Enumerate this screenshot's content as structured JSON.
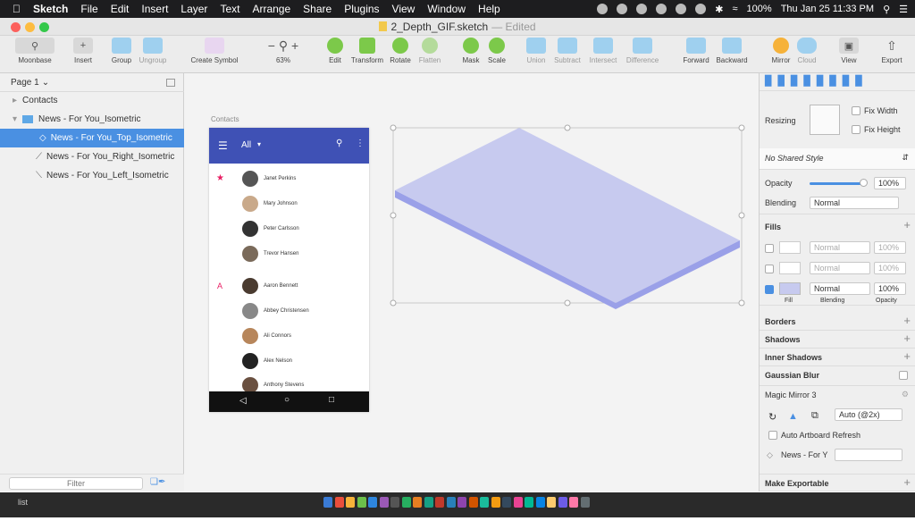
{
  "menubar": {
    "app": "Sketch",
    "items": [
      "File",
      "Edit",
      "Insert",
      "Layer",
      "Text",
      "Arrange",
      "Share",
      "Plugins",
      "View",
      "Window",
      "Help"
    ],
    "battery": "100%",
    "clock": "Thu Jan 25  11:33 PM"
  },
  "window": {
    "title": "2_Depth_GIF.sketch",
    "edited": "— Edited"
  },
  "toolbar": {
    "moonbase": "Moonbase",
    "insert": "Insert",
    "group": "Group",
    "ungroup": "Ungroup",
    "create_symbol": "Create Symbol",
    "zoom": "63%",
    "edit": "Edit",
    "transform": "Transform",
    "rotate": "Rotate",
    "flatten": "Flatten",
    "mask": "Mask",
    "scale": "Scale",
    "union": "Union",
    "subtract": "Subtract",
    "intersect": "Intersect",
    "difference": "Difference",
    "forward": "Forward",
    "backward": "Backward",
    "mirror": "Mirror",
    "cloud": "Cloud",
    "view": "View",
    "export": "Export"
  },
  "layers": {
    "page": "Page 1",
    "items": [
      {
        "label": "Contacts"
      },
      {
        "label": "News - For You_Isometric"
      },
      {
        "label": "News - For You_Top_Isometric"
      },
      {
        "label": "News - For You_Right_Isometric"
      },
      {
        "label": "News - For You_Left_Isometric"
      }
    ],
    "filter_placeholder": "Filter"
  },
  "canvas": {
    "artboard_label": "Contacts",
    "phone": {
      "toolbar_title": "All",
      "contacts": [
        {
          "name": "Janet Perkins"
        },
        {
          "name": "Mary Johnson"
        },
        {
          "name": "Peter Carlsson"
        },
        {
          "name": "Trevor Hansen"
        },
        {
          "name": "Aaron Bennett"
        },
        {
          "name": "Abbey Christensen"
        },
        {
          "name": "Ali Connors"
        },
        {
          "name": "Alex Nelson"
        },
        {
          "name": "Anthony Stevens"
        }
      ],
      "letter_a": "A",
      "star": "★"
    },
    "colors": {
      "top": "#c7caef",
      "side": "#9aa0e8"
    }
  },
  "inspector": {
    "resizing": "Resizing",
    "fix_width": "Fix Width",
    "fix_height": "Fix Height",
    "shared_style": "No Shared Style",
    "opacity_label": "Opacity",
    "opacity_value": "100%",
    "blending_label": "Blending",
    "blending_value": "Normal",
    "fills": "Fills",
    "fill_rows": [
      {
        "mode": "Normal",
        "opacity": "100%"
      },
      {
        "mode": "Normal",
        "opacity": "100%"
      },
      {
        "mode": "Normal",
        "opacity": "100%"
      }
    ],
    "fill_caption": "Fill",
    "blending_caption": "Blending",
    "opacity_caption": "Opacity",
    "borders": "Borders",
    "shadows": "Shadows",
    "inner_shadows": "Inner Shadows",
    "gaussian_blur": "Gaussian Blur",
    "magic_mirror": "Magic Mirror 3",
    "auto_scale": "Auto (@2x)",
    "auto_refresh": "Auto Artboard Refresh",
    "mirror_target": "News - For Y",
    "make_exportable": "Make Exportable"
  },
  "dock": {
    "list_label": "list"
  }
}
